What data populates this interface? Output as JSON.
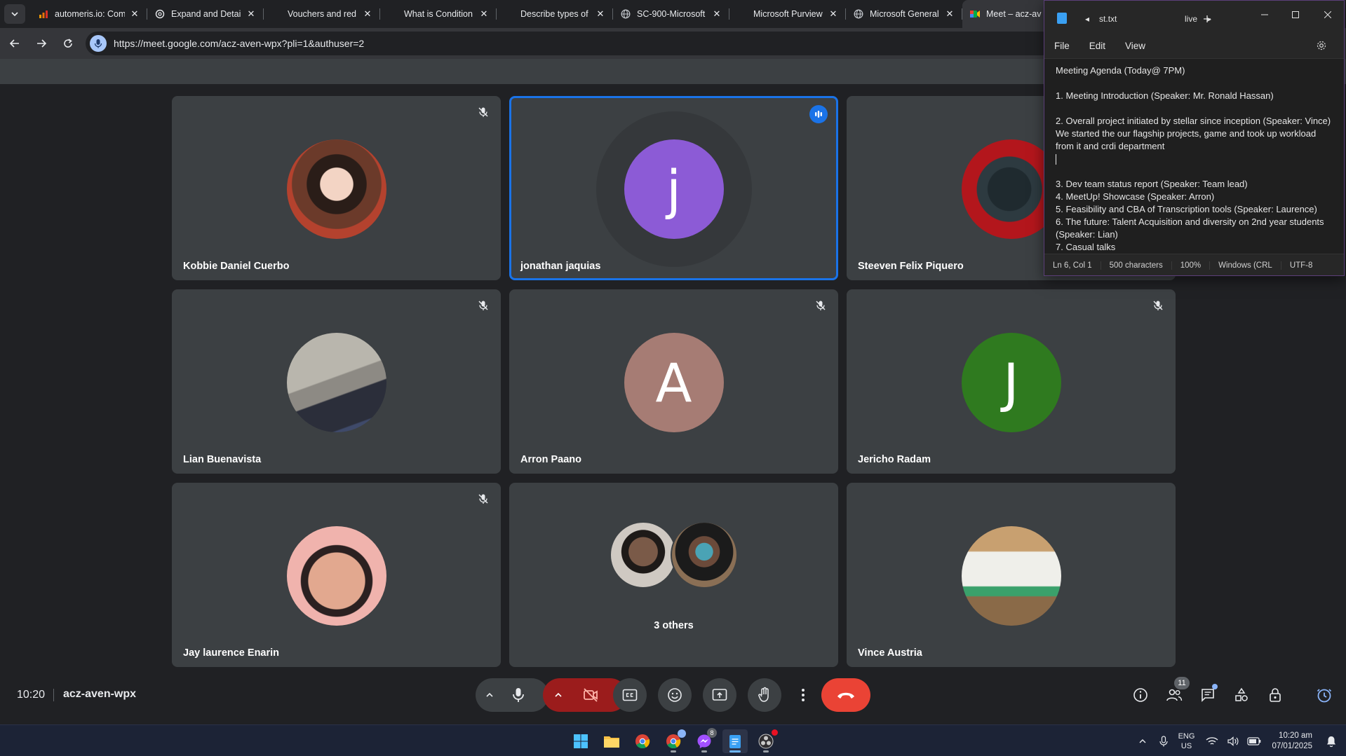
{
  "browser": {
    "tabs": [
      {
        "title": "automeris.io: Com",
        "icon": "chart-bars-icon"
      },
      {
        "title": "Expand and Detai",
        "icon": "openai-icon"
      },
      {
        "title": "Vouchers and red",
        "icon": "microsoft-icon"
      },
      {
        "title": "What is Condition",
        "icon": "microsoft-icon"
      },
      {
        "title": "Describe types of",
        "icon": "microsoft-icon"
      },
      {
        "title": "SC-900-Microsoft",
        "icon": "globe-icon"
      },
      {
        "title": "Microsoft Purview",
        "icon": "microsoft-icon"
      },
      {
        "title": "Microsoft General",
        "icon": "globe-icon"
      },
      {
        "title": "Meet – acz-av",
        "icon": "meet-icon"
      }
    ],
    "url": "https://meet.google.com/acz-aven-wpx?pli=1&authuser=2"
  },
  "meet": {
    "participants": [
      {
        "name": "Kobbie Daniel Cuerbo",
        "avatar": "photo",
        "muted": true
      },
      {
        "name": "jonathan jaquias",
        "avatar": "letter",
        "letter": "j",
        "color": "#8c5bd6",
        "speaking": true
      },
      {
        "name": "Steeven Felix Piquero",
        "avatar": "photo",
        "muted": false
      },
      {
        "name": "Lian Buenavista",
        "avatar": "photo",
        "muted": true
      },
      {
        "name": "Arron Paano",
        "avatar": "letter",
        "letter": "A",
        "color": "#a67c74",
        "muted": true
      },
      {
        "name": "Jericho Radam",
        "avatar": "letter",
        "letter": "J",
        "color": "#2f7a1f",
        "muted": true
      },
      {
        "name": "Jay laurence Enarin",
        "avatar": "photo",
        "muted": true
      },
      {
        "name": "Vince Austria",
        "avatar": "photo",
        "muted": false
      }
    ],
    "others_label": "3 others",
    "time": "10:20",
    "meeting_code": "acz-aven-wpx",
    "people_count": "11",
    "controls": [
      "chevron-up-icon",
      "mic-icon",
      "camera-off-icon",
      "captions-icon",
      "emoji-icon",
      "present-icon",
      "raise-hand-icon",
      "more-icon",
      "hang-up-icon"
    ],
    "right_controls": [
      "info-icon",
      "people-icon",
      "chat-icon",
      "activities-icon",
      "host-controls-icon",
      "timer-icon"
    ]
  },
  "notepad": {
    "tab_title": "st.txt",
    "tab2_title": "live",
    "menu": [
      "File",
      "Edit",
      "View"
    ],
    "lines": [
      "Meeting Agenda (Today@ 7PM)",
      "",
      "1. Meeting Introduction (Speaker: Mr. Ronald Hassan)",
      "",
      "2. Overall project initiated by stellar since inception (Speaker: Vince) We started the our flagship projects, game and took up workload from it and crdi department",
      "",
      "",
      "3. Dev team status report (Speaker: Team lead)",
      "4. MeetUp! Showcase (Speaker: Arron)",
      "5. Feasibility and CBA of Transcription tools (Speaker: Laurence)",
      "6. The future: Talent Acquisition and diversity on 2nd year students (Speaker: Lian)",
      "7. Casual talks"
    ],
    "status": {
      "position": "Ln 6, Col 1",
      "chars": "500 characters",
      "zoom": "100%",
      "eol": "Windows (CRL",
      "encoding": "UTF-8"
    }
  },
  "taskbar": {
    "apps": [
      "windows-start-icon",
      "file-explorer-icon",
      "chrome-icon",
      "chrome-profile-icon",
      "messenger-icon",
      "notepad-icon",
      "obs-icon"
    ],
    "messenger_badge": "8",
    "lang_top": "ENG",
    "lang_bottom": "US",
    "time": "10:20 am",
    "date": "07/01/2025"
  }
}
